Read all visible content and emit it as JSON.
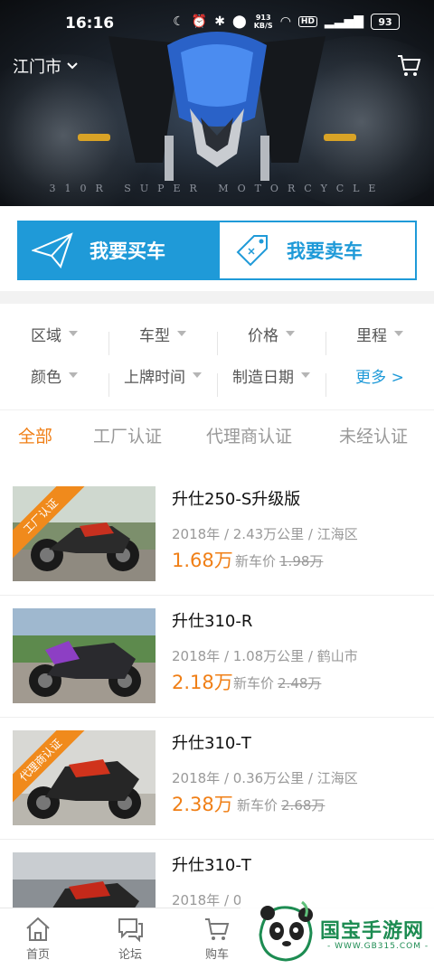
{
  "status_bar": {
    "time": "16:16",
    "speed_value": "913",
    "speed_unit": "KB/S",
    "hd": "HD",
    "battery": "93"
  },
  "header": {
    "city": "江门市",
    "cart_icon": "cart-icon",
    "banner_caption": "310R SUPER MOTORCYCLE"
  },
  "actions": {
    "buy_label": "我要买车",
    "sell_label": "我要卖车"
  },
  "filters": {
    "row1": [
      "区域",
      "车型",
      "价格",
      "里程"
    ],
    "row2": [
      "颜色",
      "上牌时间",
      "制造日期"
    ],
    "more": "更多 >"
  },
  "tabs": [
    {
      "label": "全部",
      "active": true
    },
    {
      "label": "工厂认证",
      "active": false
    },
    {
      "label": "代理商认证",
      "active": false
    },
    {
      "label": "未经认证",
      "active": false
    }
  ],
  "listings": [
    {
      "title": "升仕250-S升级版",
      "meta": "2018年 / 2.43万公里 / 江海区",
      "price": "1.68万",
      "new_price_label": "新车价",
      "new_price": "1.98万",
      "badge": "工厂认证"
    },
    {
      "title": "升仕310-R",
      "meta": "2018年 / 1.08万公里 / 鹤山市",
      "price": "2.18万",
      "new_price_label": "新车价",
      "new_price": "2.48万",
      "badge": ""
    },
    {
      "title": "升仕310-T",
      "meta": "2018年 / 0.36万公里 / 江海区",
      "price": "2.38万",
      "new_price_label": "新车价",
      "new_price": "2.68万",
      "badge": "代理商认证"
    },
    {
      "title": "升仕310-T",
      "meta": "2018年 / 0",
      "price": "",
      "new_price_label": "",
      "new_price": "",
      "badge": ""
    }
  ],
  "bottom_nav": [
    {
      "label": "首页",
      "icon": "home-icon"
    },
    {
      "label": "论坛",
      "icon": "forum-icon"
    },
    {
      "label": "购车",
      "icon": "cart-icon"
    }
  ],
  "watermark": {
    "text": "国宝手游网",
    "url": "- WWW.GB315.COM -"
  },
  "colors": {
    "accent_blue": "#1f9ad8",
    "accent_orange": "#f07f16"
  }
}
